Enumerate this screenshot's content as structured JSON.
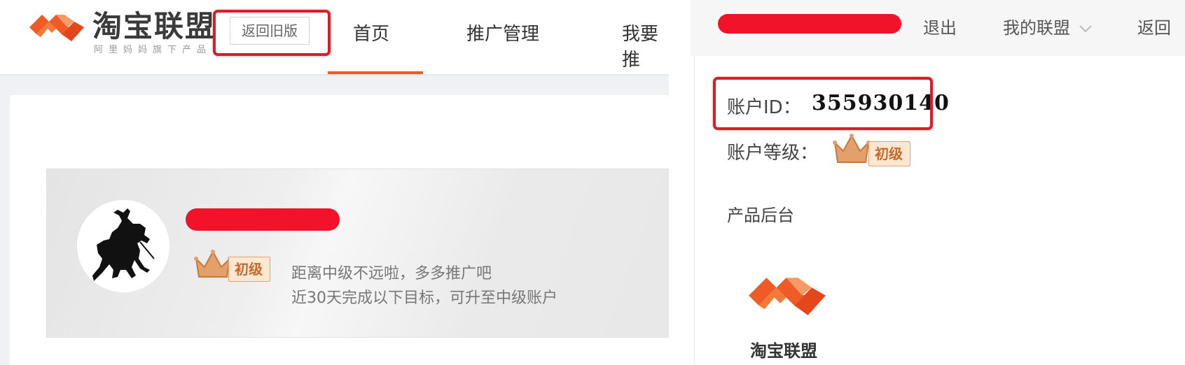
{
  "left": {
    "logo": {
      "name": "淘宝联盟",
      "subtitle": "阿里妈妈旗下产品"
    },
    "old_version_button": "返回旧版",
    "nav": [
      "首页",
      "推广管理",
      "我要推"
    ],
    "nav_active_index": 0,
    "profile": {
      "level_badge": "初级",
      "hint_line1": "距离中级不远啦，多多推广吧",
      "hint_line2": "近30天完成以下目标，可升至中级账户"
    }
  },
  "right": {
    "header": {
      "logout": "退出",
      "my_union": "我的联盟",
      "back": "返回"
    },
    "account_id_label": "账户ID：",
    "account_id_value": "355930140",
    "account_level_label": "账户等级：",
    "level_badge": "初级",
    "product_backend_label": "产品后台",
    "product_logo_name": "淘宝联盟"
  },
  "colors": {
    "brand_orange": "#ef5a27",
    "highlight_red": "#d4202b",
    "redaction_red": "#f2122a",
    "badge_text": "#c9692b",
    "badge_bg": "#fbe7d2"
  },
  "icons": [
    "taobao-union-logo-icon",
    "crown-icon",
    "chevron-down-icon",
    "knight-avatar-icon"
  ]
}
